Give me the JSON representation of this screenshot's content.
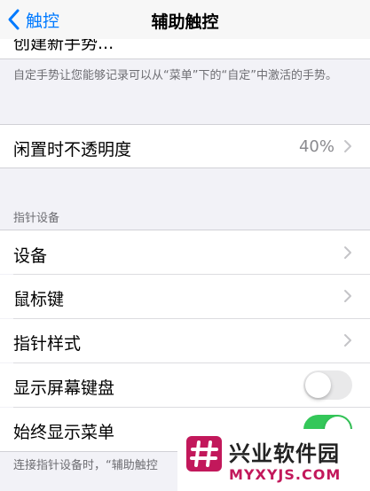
{
  "nav": {
    "back_label": "触控",
    "title": "辅助触控"
  },
  "partial_row": {
    "label": "创建新手势..."
  },
  "custom_footnote": "自定手势让您能够记录可以从“菜单”下的“自定”中激活的手势。",
  "idle_opacity": {
    "label": "闲置时不透明度",
    "value": "40%"
  },
  "pointer_section": {
    "header": "指针设备",
    "items": [
      {
        "label": "设备"
      },
      {
        "label": "鼠标键"
      },
      {
        "label": "指针样式"
      }
    ],
    "show_keyboard": {
      "label": "显示屏幕键盘",
      "state": "off"
    },
    "always_show_menu": {
      "label": "始终显示菜单",
      "state": "on"
    }
  },
  "bottom_footnote": "连接指针设备时，“辅助触控",
  "watermark": {
    "cn": "兴业软件园",
    "en": "MYXYJS.COM"
  },
  "colors": {
    "accent": "#007aff",
    "toggle_on": "#34c759",
    "watermark_accent": "#c2185b"
  }
}
